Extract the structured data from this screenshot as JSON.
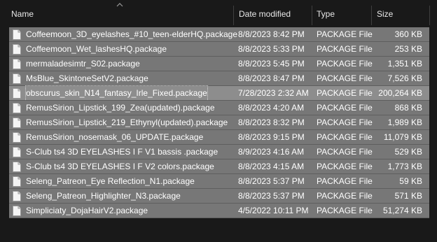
{
  "columns": {
    "name": "Name",
    "date": "Date modified",
    "type": "Type",
    "size": "Size"
  },
  "files": [
    {
      "name": "Coffeemoon_3D_eyelashes_#10_teen-elderHQ.package",
      "date": "8/8/2023 8:42 PM",
      "type": "PACKAGE File",
      "size": "360 KB"
    },
    {
      "name": "Coffeemoon_Wet_lashesHQ.package",
      "date": "8/8/2023 5:33 PM",
      "type": "PACKAGE File",
      "size": "253 KB"
    },
    {
      "name": "mermaladesimtr_S02.package",
      "date": "8/8/2023 5:45 PM",
      "type": "PACKAGE File",
      "size": "1,351 KB"
    },
    {
      "name": "MsBlue_SkintoneSetV2.package",
      "date": "8/8/2023 8:47 PM",
      "type": "PACKAGE File",
      "size": "7,526 KB"
    },
    {
      "name": "obscurus_skin_N14_fantasy_Irle_Fixed.package",
      "date": "7/28/2023 2:32 AM",
      "type": "PACKAGE File",
      "size": "200,264 KB"
    },
    {
      "name": "RemusSirion_Lipstick_199_Zea(updated).package",
      "date": "8/8/2023 4:20 AM",
      "type": "PACKAGE File",
      "size": "868 KB"
    },
    {
      "name": "RemusSirion_Lipstick_219_Ethynyl(updated).package",
      "date": "8/8/2023 8:32 PM",
      "type": "PACKAGE File",
      "size": "1,989 KB"
    },
    {
      "name": "RemusSirion_nosemask_06_UPDATE.package",
      "date": "8/8/2023 9:15 PM",
      "type": "PACKAGE File",
      "size": "11,079 KB"
    },
    {
      "name": "S-Club ts4 3D EYELASHES I F V1 bassis .package",
      "date": "8/9/2023 4:16 AM",
      "type": "PACKAGE File",
      "size": "529 KB"
    },
    {
      "name": "S-Club ts4 3D EYELASHES I F V2 colors.package",
      "date": "8/8/2023 4:15 AM",
      "type": "PACKAGE File",
      "size": "1,773 KB"
    },
    {
      "name": "Seleng_Patreon_Eye Reflection_N1.package",
      "date": "8/8/2023 5:37 PM",
      "type": "PACKAGE File",
      "size": "59 KB"
    },
    {
      "name": "Seleng_Patreon_Highlighter_N3.package",
      "date": "8/8/2023 5:37 PM",
      "type": "PACKAGE File",
      "size": "571 KB"
    },
    {
      "name": "Simpliciaty_DojaHairV2.package",
      "date": "4/5/2022 10:11 PM",
      "type": "PACKAGE File",
      "size": "51,274 KB"
    }
  ],
  "focused_index": 4,
  "icon": "file-icon",
  "colors": {
    "background": "#191919",
    "selected_row": "#777777",
    "focused_row": "#8d8d8d"
  }
}
